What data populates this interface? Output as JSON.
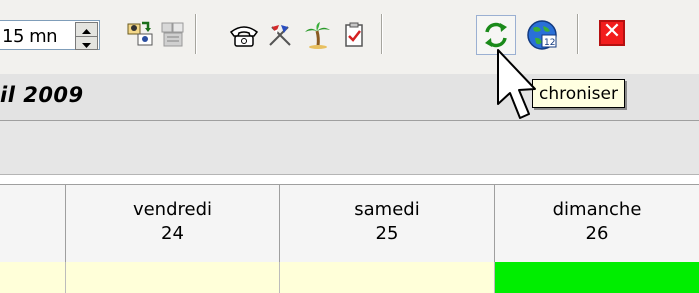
{
  "toolbar": {
    "interval_value": "15 mn",
    "tooltip": "chroniser",
    "close_glyph": "✕",
    "icons": [
      "user-swap-icon",
      "user-grid-icon",
      "phone-icon",
      "flags-icon",
      "palm-tree-icon",
      "clipboard-check-icon",
      "sync-icon",
      "globe-icon",
      "close-icon"
    ]
  },
  "header": {
    "date_label": "il 2009"
  },
  "grid": {
    "columns": [
      {
        "day": "",
        "num": "",
        "fill": "#ffffd9"
      },
      {
        "day": "vendredi",
        "num": "24",
        "fill": "#ffffd9"
      },
      {
        "day": "samedi",
        "num": "25",
        "fill": "#ffffd9"
      },
      {
        "day": "dimanche",
        "num": "26",
        "fill": "#00ee00"
      }
    ]
  },
  "colors": {
    "weekday_fill": "#ffffd9",
    "highlight_fill": "#00ee00",
    "close_red": "#f21d1d"
  }
}
